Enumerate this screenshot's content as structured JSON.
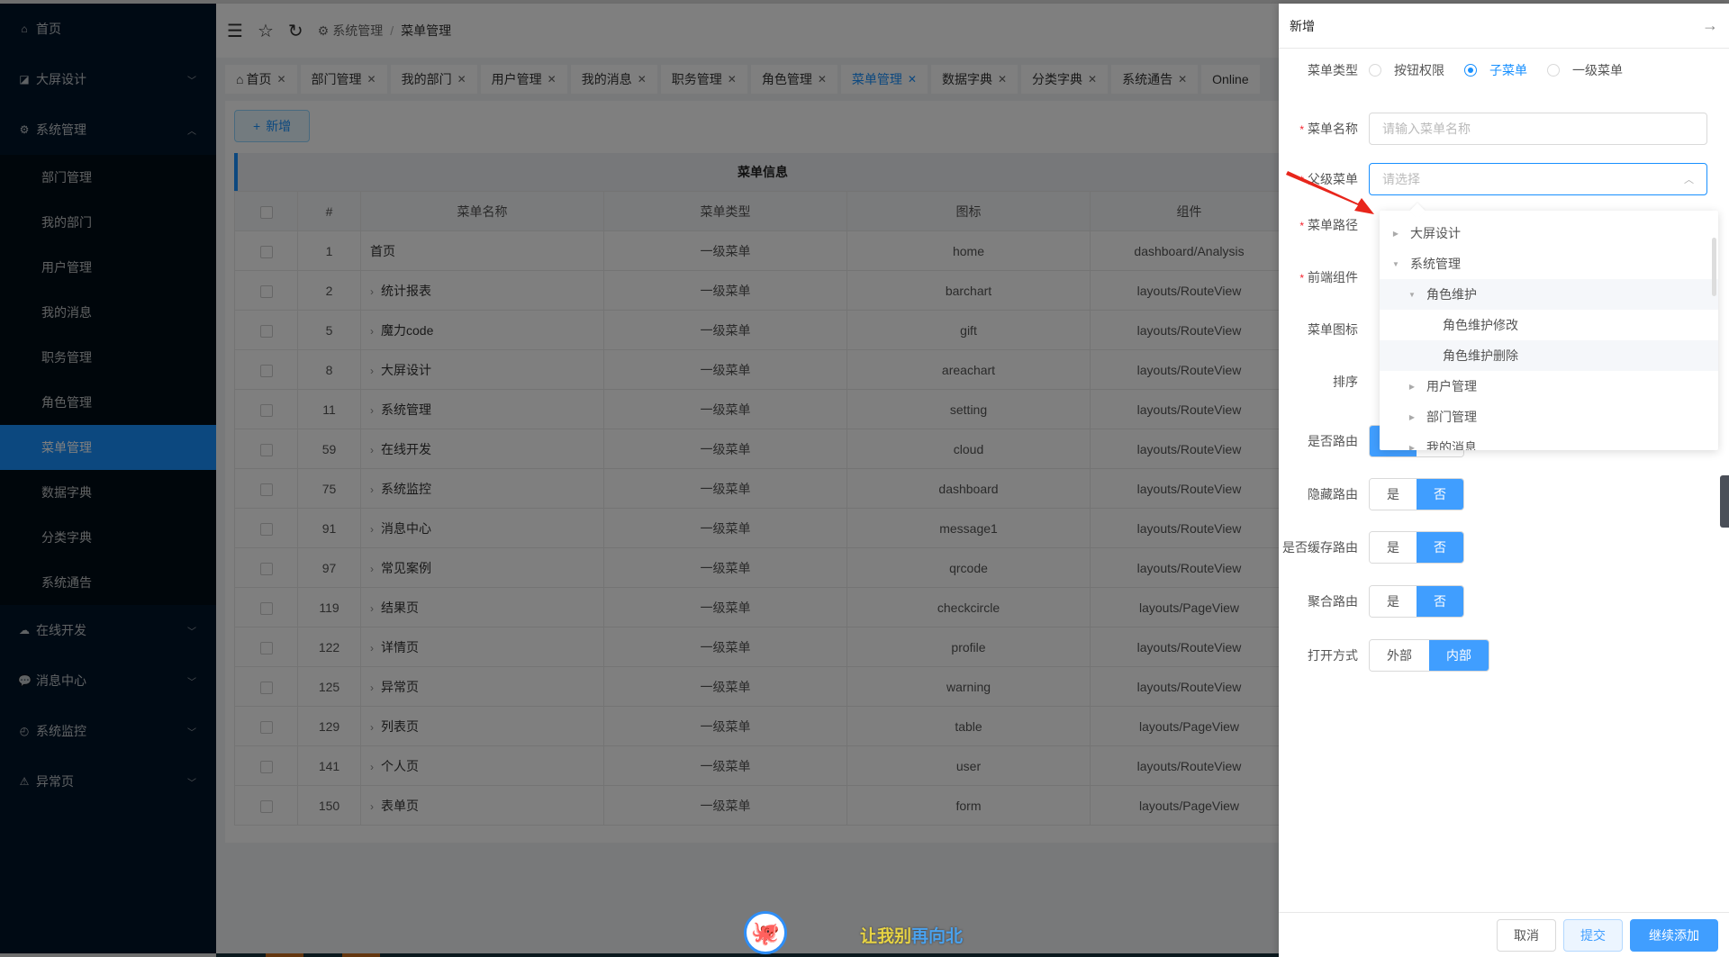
{
  "sidebar": {
    "items": [
      {
        "label": "首页",
        "icon": "home-icon"
      },
      {
        "label": "大屏设计",
        "icon": "area-chart-icon",
        "expanded": false
      },
      {
        "label": "系统管理",
        "icon": "setting-icon",
        "expanded": true,
        "children": [
          "部门管理",
          "我的部门",
          "用户管理",
          "我的消息",
          "职务管理",
          "角色管理",
          "菜单管理",
          "数据字典",
          "分类字典",
          "系统通告"
        ],
        "active_child": "菜单管理"
      },
      {
        "label": "在线开发",
        "icon": "cloud-icon",
        "expanded": false
      },
      {
        "label": "消息中心",
        "icon": "message-icon",
        "expanded": false
      },
      {
        "label": "系统监控",
        "icon": "dashboard-icon",
        "expanded": false
      },
      {
        "label": "异常页",
        "icon": "warning-icon",
        "expanded": false
      }
    ]
  },
  "topbar": {
    "breadcrumb": [
      "系统管理",
      "菜单管理"
    ]
  },
  "tabs": [
    {
      "label": "首页",
      "icon": "home-icon"
    },
    {
      "label": "部门管理"
    },
    {
      "label": "我的部门"
    },
    {
      "label": "用户管理"
    },
    {
      "label": "我的消息"
    },
    {
      "label": "职务管理"
    },
    {
      "label": "角色管理"
    },
    {
      "label": "菜单管理",
      "active": true
    },
    {
      "label": "数据字典"
    },
    {
      "label": "分类字典"
    },
    {
      "label": "系统通告"
    },
    {
      "label": "Online"
    }
  ],
  "toolbar": {
    "add_label": "新增"
  },
  "table": {
    "title": "菜单信息",
    "columns": [
      "#",
      "菜单名称",
      "菜单类型",
      "图标",
      "组件"
    ],
    "rows": [
      {
        "id": "1",
        "name": "首页",
        "type": "一级菜单",
        "icon": "home",
        "component": "dashboard/Analysis",
        "expandable": false
      },
      {
        "id": "2",
        "name": "统计报表",
        "type": "一级菜单",
        "icon": "barchart",
        "component": "layouts/RouteView",
        "expandable": true
      },
      {
        "id": "5",
        "name": "魔力code",
        "type": "一级菜单",
        "icon": "gift",
        "component": "layouts/RouteView",
        "expandable": true
      },
      {
        "id": "8",
        "name": "大屏设计",
        "type": "一级菜单",
        "icon": "areachart",
        "component": "layouts/RouteView",
        "expandable": true
      },
      {
        "id": "11",
        "name": "系统管理",
        "type": "一级菜单",
        "icon": "setting",
        "component": "layouts/RouteView",
        "expandable": true
      },
      {
        "id": "59",
        "name": "在线开发",
        "type": "一级菜单",
        "icon": "cloud",
        "component": "layouts/RouteView",
        "expandable": true
      },
      {
        "id": "75",
        "name": "系统监控",
        "type": "一级菜单",
        "icon": "dashboard",
        "component": "layouts/RouteView",
        "expandable": true
      },
      {
        "id": "91",
        "name": "消息中心",
        "type": "一级菜单",
        "icon": "message1",
        "component": "layouts/RouteView",
        "expandable": true
      },
      {
        "id": "97",
        "name": "常见案例",
        "type": "一级菜单",
        "icon": "qrcode",
        "component": "layouts/RouteView",
        "expandable": true
      },
      {
        "id": "119",
        "name": "结果页",
        "type": "一级菜单",
        "icon": "checkcircle",
        "component": "layouts/PageView",
        "expandable": true
      },
      {
        "id": "122",
        "name": "详情页",
        "type": "一级菜单",
        "icon": "profile",
        "component": "layouts/RouteView",
        "expandable": true
      },
      {
        "id": "125",
        "name": "异常页",
        "type": "一级菜单",
        "icon": "warning",
        "component": "layouts/RouteView",
        "expandable": true
      },
      {
        "id": "129",
        "name": "列表页",
        "type": "一级菜单",
        "icon": "table",
        "component": "layouts/PageView",
        "expandable": true
      },
      {
        "id": "141",
        "name": "个人页",
        "type": "一级菜单",
        "icon": "user",
        "component": "layouts/RouteView",
        "expandable": true
      },
      {
        "id": "150",
        "name": "表单页",
        "type": "一级菜单",
        "icon": "form",
        "component": "layouts/PageView",
        "expandable": true
      }
    ]
  },
  "drawer": {
    "title": "新增",
    "menu_type": {
      "label": "菜单类型",
      "options": [
        "按钮权限",
        "子菜单",
        "一级菜单"
      ],
      "selected": "子菜单"
    },
    "menu_name": {
      "label": "菜单名称",
      "placeholder": "请输入菜单名称",
      "value": ""
    },
    "parent_menu": {
      "label": "父级菜单",
      "placeholder": "请选择"
    },
    "menu_path": {
      "label": "菜单路径"
    },
    "frontend_component": {
      "label": "前端组件"
    },
    "menu_icon": {
      "label": "菜单图标"
    },
    "sort": {
      "label": "排序"
    },
    "is_route": {
      "label": "是否路由",
      "options": [
        "是",
        "否"
      ],
      "selected": "是"
    },
    "hidden_route": {
      "label": "隐藏路由",
      "options": [
        "是",
        "否"
      ],
      "selected": "否"
    },
    "cache_route": {
      "label": "是否缓存路由",
      "options": [
        "是",
        "否"
      ],
      "selected": "否"
    },
    "aggregate_route": {
      "label": "聚合路由",
      "options": [
        "是",
        "否"
      ],
      "selected": "否"
    },
    "open_mode": {
      "label": "打开方式",
      "options": [
        "外部",
        "内部"
      ],
      "selected": "内部"
    },
    "tree": [
      {
        "label": "大屏设计",
        "level": 0,
        "caret": "collapsed"
      },
      {
        "label": "系统管理",
        "level": 0,
        "caret": "expanded"
      },
      {
        "label": "角色维护",
        "level": 1,
        "caret": "expanded",
        "highlight": true
      },
      {
        "label": "角色维护修改",
        "level": 2,
        "caret": "none"
      },
      {
        "label": "角色维护删除",
        "level": 2,
        "caret": "none",
        "highlight": true
      },
      {
        "label": "用户管理",
        "level": 1,
        "caret": "collapsed"
      },
      {
        "label": "部门管理",
        "level": 1,
        "caret": "collapsed"
      },
      {
        "label": "我的消息",
        "level": 1,
        "caret": "collapsed"
      }
    ],
    "footer": {
      "cancel": "取消",
      "submit": "提交",
      "continue_add": "继续添加"
    }
  },
  "overlay": {
    "signature_yellow": "让我别",
    "signature_blue": "再向北"
  },
  "colors": {
    "primary": "#1890ff",
    "toggle_on": "#409eff",
    "sidebar_bg": "#001529",
    "required": "#f5222d"
  }
}
